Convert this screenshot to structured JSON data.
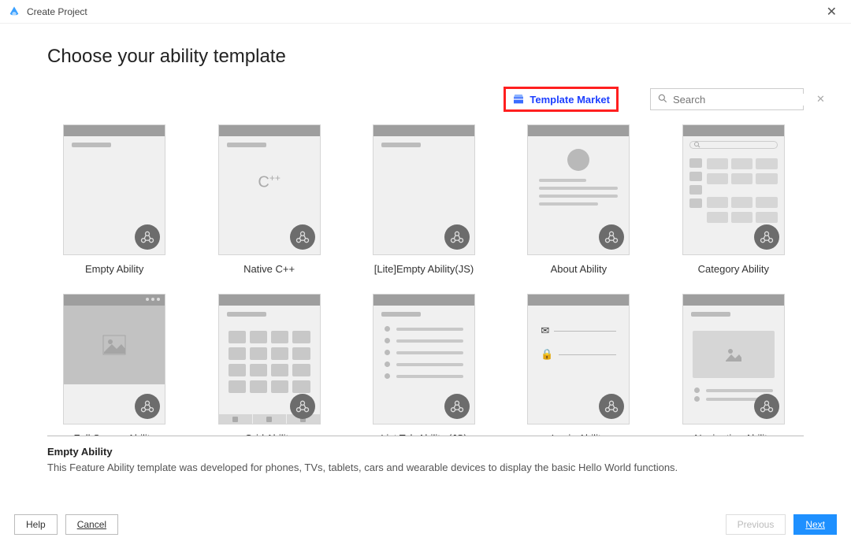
{
  "window": {
    "title": "Create Project"
  },
  "heading": "Choose your ability template",
  "template_market_label": "Template Market",
  "search": {
    "placeholder": "Search"
  },
  "templates": [
    {
      "label": "Empty Ability",
      "kind": "empty"
    },
    {
      "label": "Native C++",
      "kind": "cpp"
    },
    {
      "label": "[Lite]Empty Ability(JS)",
      "kind": "empty"
    },
    {
      "label": "About Ability",
      "kind": "about"
    },
    {
      "label": "Category Ability",
      "kind": "category"
    },
    {
      "label": "Full Screen Ability",
      "kind": "fullscreen"
    },
    {
      "label": "Grid Ability",
      "kind": "grid"
    },
    {
      "label": "List Tab Ability (JS)",
      "kind": "list"
    },
    {
      "label": "Login Ability",
      "kind": "login"
    },
    {
      "label": "Navigation Ability",
      "kind": "nav"
    }
  ],
  "selected": {
    "title": "Empty Ability",
    "description": "This Feature Ability template was developed for phones, TVs, tablets, cars and wearable devices to display the basic Hello World functions."
  },
  "buttons": {
    "help": "Help",
    "cancel": "Cancel",
    "previous": "Previous",
    "next": "Next"
  }
}
